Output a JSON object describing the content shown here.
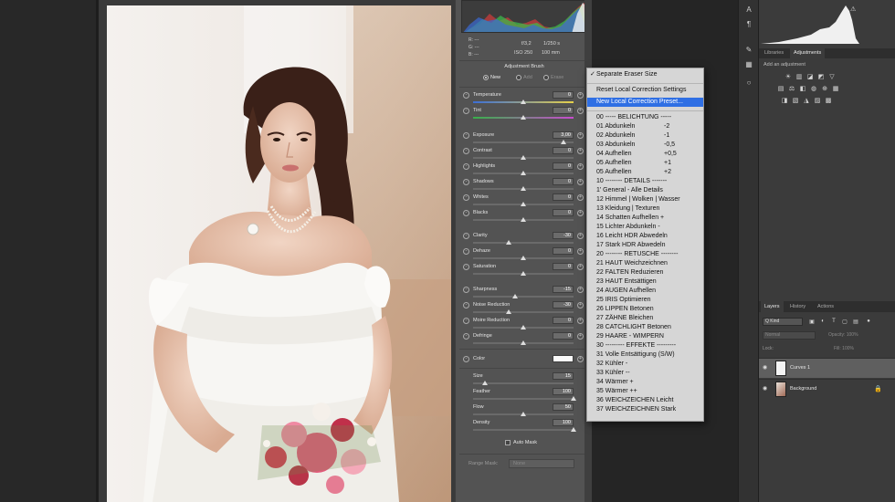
{
  "histogram_info": {
    "rgb_labels": [
      "R:",
      "G:",
      "B:"
    ],
    "rgb_dashes": [
      "---",
      "---",
      "---"
    ],
    "aperture": "f/3,2",
    "shutter": "1/250 s",
    "iso": "ISO 250",
    "focal": "100 mm"
  },
  "adjustment_brush": {
    "title": "Adjustment Brush",
    "modes": [
      {
        "label": "New",
        "selected": true
      },
      {
        "label": "Add",
        "selected": false
      },
      {
        "label": "Erase",
        "selected": false
      }
    ],
    "sliders": [
      {
        "label": "Temperature",
        "value": "0",
        "level": 0.5
      },
      {
        "label": "Tint",
        "value": "0",
        "level": 0.5
      },
      {
        "label": "Exposure",
        "value": "3,00",
        "level": 0.9
      },
      {
        "label": "Contrast",
        "value": "0",
        "level": 0.5
      },
      {
        "label": "Highlights",
        "value": "0",
        "level": 0.5
      },
      {
        "label": "Shadows",
        "value": "0",
        "level": 0.5
      },
      {
        "label": "Whites",
        "value": "0",
        "level": 0.5
      },
      {
        "label": "Blacks",
        "value": "0",
        "level": 0.5
      },
      {
        "label": "Clarity",
        "value": "-30",
        "level": 0.35
      },
      {
        "label": "Dehaze",
        "value": "0",
        "level": 0.5
      },
      {
        "label": "Saturation",
        "value": "0",
        "level": 0.5
      },
      {
        "label": "Sharpness",
        "value": "-15",
        "level": 0.42
      },
      {
        "label": "Noise Reduction",
        "value": "-30",
        "level": 0.35
      },
      {
        "label": "Moire Reduction",
        "value": "0",
        "level": 0.5
      },
      {
        "label": "Defringe",
        "value": "0",
        "level": 0.5
      }
    ],
    "color_label": "Color",
    "brush": [
      {
        "label": "Size",
        "value": "15",
        "level": 0.12
      },
      {
        "label": "Feather",
        "value": "100",
        "level": 1.0
      },
      {
        "label": "Flow",
        "value": "50",
        "level": 0.5
      },
      {
        "label": "Density",
        "value": "100",
        "level": 1.0
      }
    ],
    "auto_mask": "Auto Mask",
    "range_mask_label": "Range Mask:",
    "range_mask_value": "None"
  },
  "preset_menu": {
    "items": [
      {
        "text": "Separate Eraser Size",
        "checked": true
      },
      {
        "text": "Reset Local Correction Settings"
      },
      {
        "text": "New Local Correction Preset...",
        "highlighted": true
      },
      {
        "text": "00 ----- BELICHTUNG -----"
      },
      {
        "text": "01 Abdunkeln",
        "amt": "-2"
      },
      {
        "text": "02 Abdunkeln",
        "amt": "-1"
      },
      {
        "text": "03 Abdunkeln",
        "amt": "-0,5"
      },
      {
        "text": "04 Aufhellen",
        "amt": "+0,5"
      },
      {
        "text": "05 Aufhellen",
        "amt": "+1"
      },
      {
        "text": "05 Aufhellen",
        "amt": "+2"
      },
      {
        "text": "10 -------- DETAILS -------"
      },
      {
        "text": "1' General - Alle Details"
      },
      {
        "text": "12 Himmel | Wolken | Wasser"
      },
      {
        "text": "13 Kleidung | Texturen"
      },
      {
        "text": "14 Schatten Aufhellen +"
      },
      {
        "text": "15 Lichter Abdunkeln  -"
      },
      {
        "text": "16 Leicht HDR Abwedeln"
      },
      {
        "text": "17 Stark HDR Abwedeln"
      },
      {
        "text": "20 -------- RETUSCHE --------"
      },
      {
        "text": "21 HAUT Weichzeichnen"
      },
      {
        "text": "22 FALTEN Reduzieren"
      },
      {
        "text": "23 HAUT Entsättigen"
      },
      {
        "text": "24 AUGEN Aufhellen"
      },
      {
        "text": "25 IRIS Optimieren"
      },
      {
        "text": "26 LIPPEN Betonen"
      },
      {
        "text": "27 ZÄHNE Bleichen"
      },
      {
        "text": "28 CATCHLIGHT Betonen"
      },
      {
        "text": "29 HAARE - WIMPERN"
      },
      {
        "text": "30 --------- EFFEKTE ---------"
      },
      {
        "text": "31 Volle Entsättigung (S/W)"
      },
      {
        "text": "32 Kühler -"
      },
      {
        "text": "33 Kühler --"
      },
      {
        "text": "34 Wärmer +"
      },
      {
        "text": "35 Wärmer ++"
      },
      {
        "text": "36 WEICHZEICHEN Leicht"
      },
      {
        "text": "37 WEICHZEICHNEN Stark"
      }
    ]
  },
  "right_panels": {
    "tabs_top": [
      "Libraries",
      "Adjustments"
    ],
    "active_top": "Adjustments",
    "add_adjustment": "Add an adjustment",
    "tabs_layers": [
      "Layers",
      "History",
      "Actions"
    ],
    "active_layers": "Layers",
    "kind_filter": "Q Kind",
    "blend_mode": "Normal",
    "opacity_label": "Opacity: 100%",
    "lock_label": "Lock:",
    "fill_label": "Fill: 100%",
    "layers": [
      {
        "name": "Curves 1",
        "selected": true
      },
      {
        "name": "Background",
        "selected": false
      }
    ]
  },
  "colors": {
    "menu_highlight": "#2f6fe4",
    "panel_bg": "#535353",
    "menu_bg": "#d6d6d6"
  }
}
